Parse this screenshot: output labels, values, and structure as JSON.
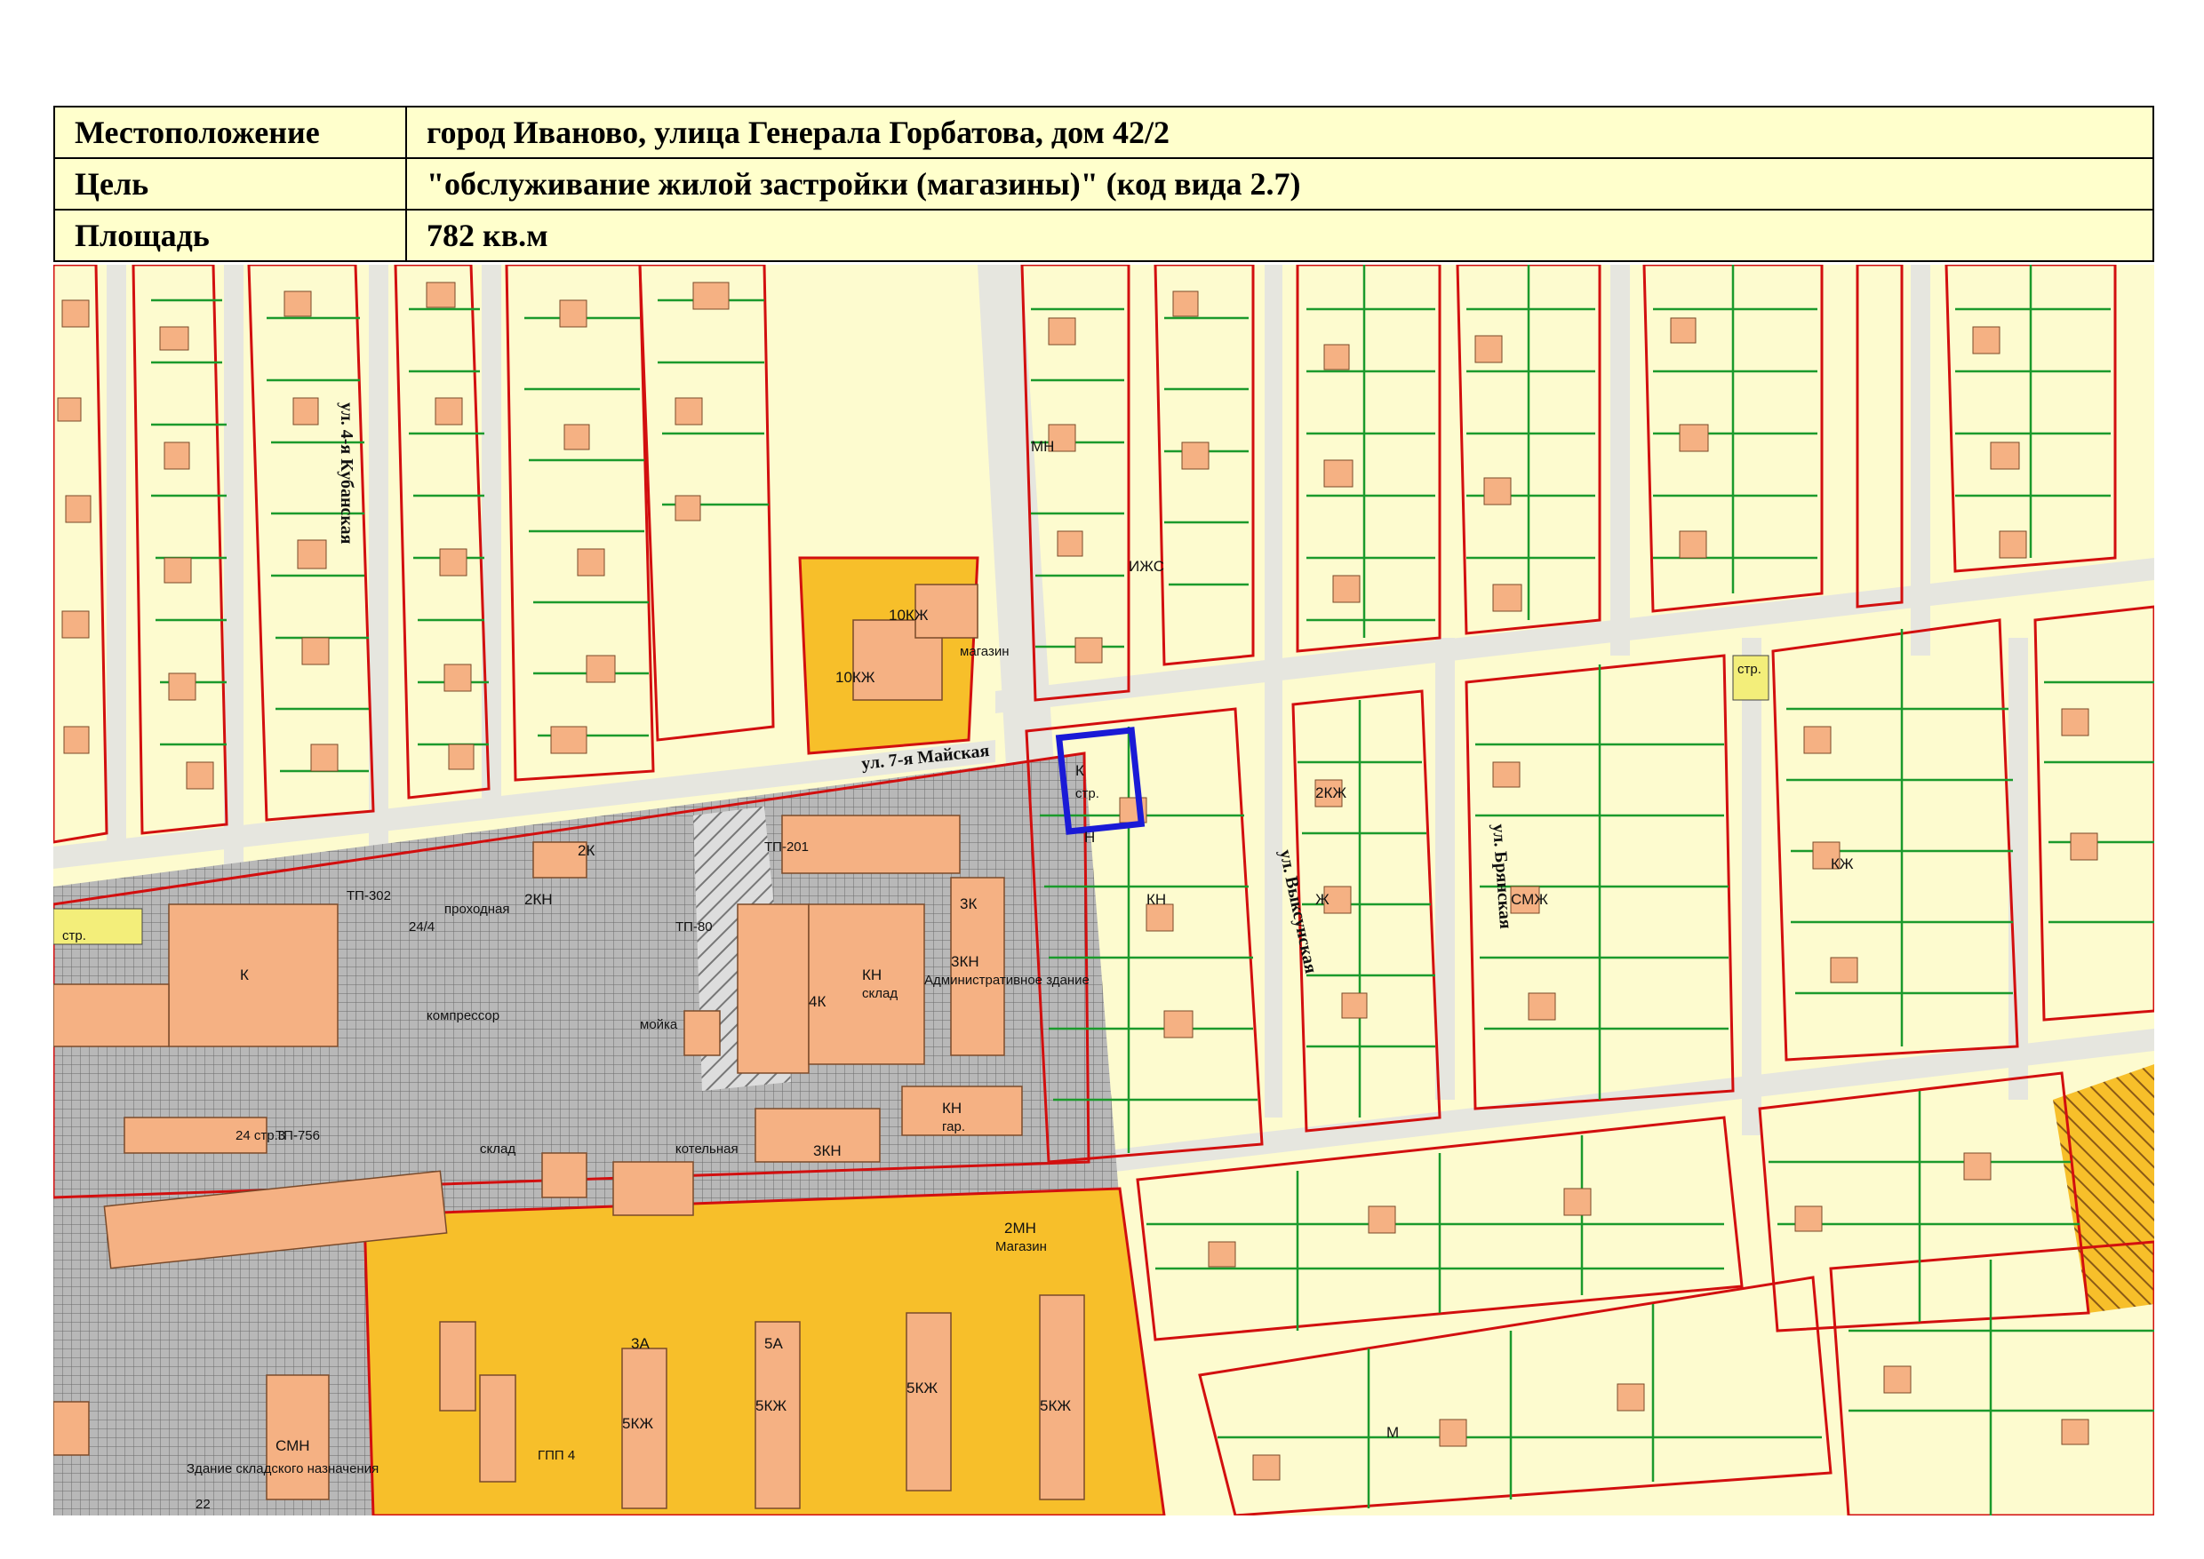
{
  "info": {
    "location_label": "Местоположение",
    "location_value": "город Иваново, улица Генерала Горбатова, дом 42/2",
    "purpose_label": "Цель",
    "purpose_value": "\"обслуживание жилой застройки (магазины)\" (код вида 2.7)",
    "area_label": "Площадь",
    "area_value": "782 кв.м"
  },
  "map": {
    "streets": {
      "kubanskaya": "ул. 4-я Кубанская",
      "maiskaya": "ул. 7-я Майская",
      "vyksunskaya": "ул. Выксунская",
      "bryanskaya": "ул. Брянская"
    },
    "labels": {
      "store": "магазин",
      "store2": "Магазин",
      "admin": "Административное здание",
      "warehouse": "склад",
      "warehouse_building": "Здание складского назначения",
      "garage": "гар.",
      "str": "стр.",
      "tp201": "ТП-201",
      "tp756": "ТП-756",
      "tp302": "ТП-302",
      "tp80": "ТП-80",
      "gpp": "ГПП 4",
      "g24_4": "24/4",
      "g24_str3": "24 стр.3",
      "g22": "22",
      "sklad_k": "склад",
      "moika": "мойка",
      "kotelnaya": "котельная",
      "proxodnaya": "проходная",
      "kompressor": "компрессор"
    },
    "building_codes": {
      "k10": "10КЖ",
      "k2mn": "2МН",
      "k3kn": "3КН",
      "k4k": "4К",
      "k3k": "3К",
      "k2k": "2К",
      "k2kn": "2КН",
      "k5a": "5А",
      "k3a": "3А",
      "k5ukzh": "5КЖ",
      "k5kzh2": "5КЖ",
      "k5kzh3": "5КЖ",
      "k5kzh4": "5КЖ",
      "smn": "СМН",
      "k": "К",
      "kn": "КН",
      "n": "Н",
      "m": "М",
      "zh": "Ж",
      "kzh": "КЖ",
      "smzh": "СМЖ",
      "izhs": "ИЖС",
      "mn": "МН",
      "k2kzh": "2КЖ"
    },
    "colors": {
      "map_bg": "#fdfbcf",
      "building": "#f5b183",
      "parcel_line": "#1b9a2c",
      "block_line": "#d20f0f",
      "industrial": "#aaaaaa",
      "commercial": "#f7bf2a",
      "target": "#1a1ad6"
    }
  }
}
